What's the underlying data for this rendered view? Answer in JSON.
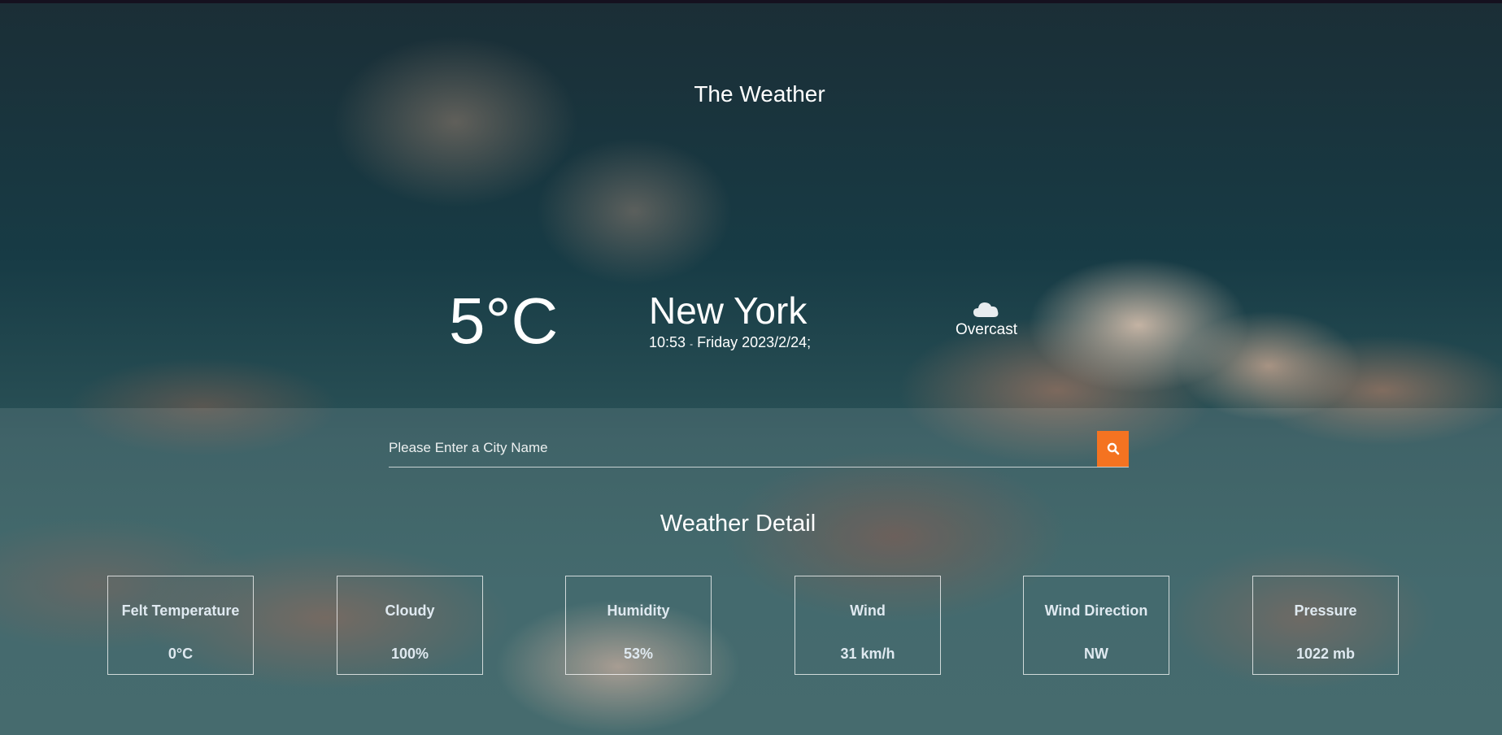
{
  "app": {
    "title": "The Weather"
  },
  "current": {
    "temperature": "5°C",
    "city": "New York",
    "time": "10:53",
    "separator": "-",
    "date": "Friday 2023/2/24;",
    "condition": "Overcast",
    "condition_icon": "cloud-icon"
  },
  "search": {
    "placeholder": "Please Enter a City Name",
    "value": "",
    "button_icon": "search-icon",
    "button_color": "#f47321"
  },
  "details": {
    "title": "Weather Detail",
    "cards": [
      {
        "label": "Felt Temperature",
        "value": "0°C"
      },
      {
        "label": "Cloudy",
        "value": "100%"
      },
      {
        "label": "Humidity",
        "value": "53%"
      },
      {
        "label": "Wind",
        "value": "31 km/h"
      },
      {
        "label": "Wind Direction",
        "value": "NW"
      },
      {
        "label": "Pressure",
        "value": "1022 mb"
      }
    ]
  }
}
